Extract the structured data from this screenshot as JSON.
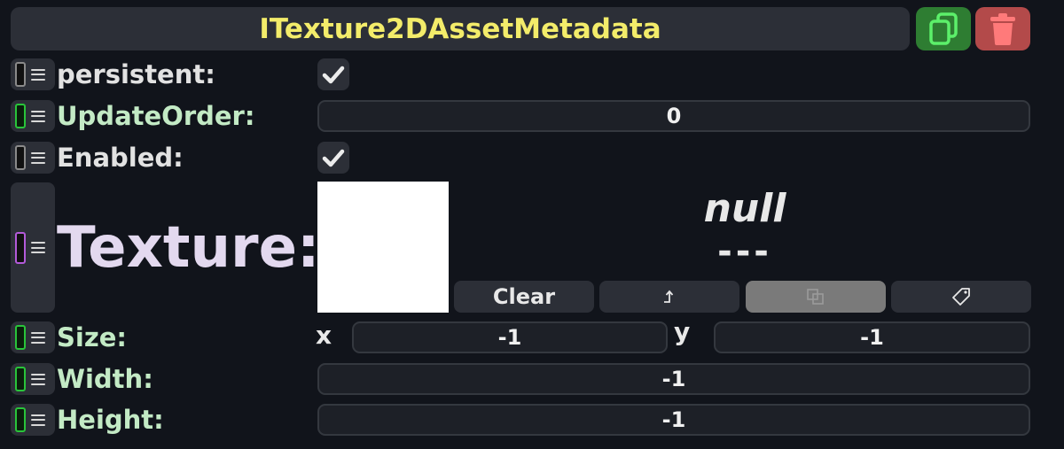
{
  "header": {
    "title": "ITexture2DAssetMetadata",
    "copy_icon": "copy-icon",
    "delete_icon": "trash-icon",
    "title_color": "#f3ec6a",
    "copy_color": "#2e7d32",
    "delete_color": "#b34a4a"
  },
  "fields": {
    "persistent": {
      "label": "persistent:",
      "checked": true
    },
    "update_order": {
      "label": "UpdateOrder:",
      "value": "0"
    },
    "enabled": {
      "label": "Enabled:",
      "checked": true
    },
    "texture": {
      "label": "Texture:",
      "asset_name": "null",
      "asset_detail": "---",
      "buttons": {
        "clear": "Clear",
        "jump_icon": "jump-arrow-icon",
        "duplicate_icon": "duplicate-icon",
        "tag_icon": "tag-icon"
      }
    },
    "size": {
      "label": "Size:",
      "x_label": "x",
      "x_value": "-1",
      "y_label": "y",
      "y_value": "-1"
    },
    "width": {
      "label": "Width:",
      "value": "-1"
    },
    "height": {
      "label": "Height:",
      "value": "-1"
    }
  }
}
